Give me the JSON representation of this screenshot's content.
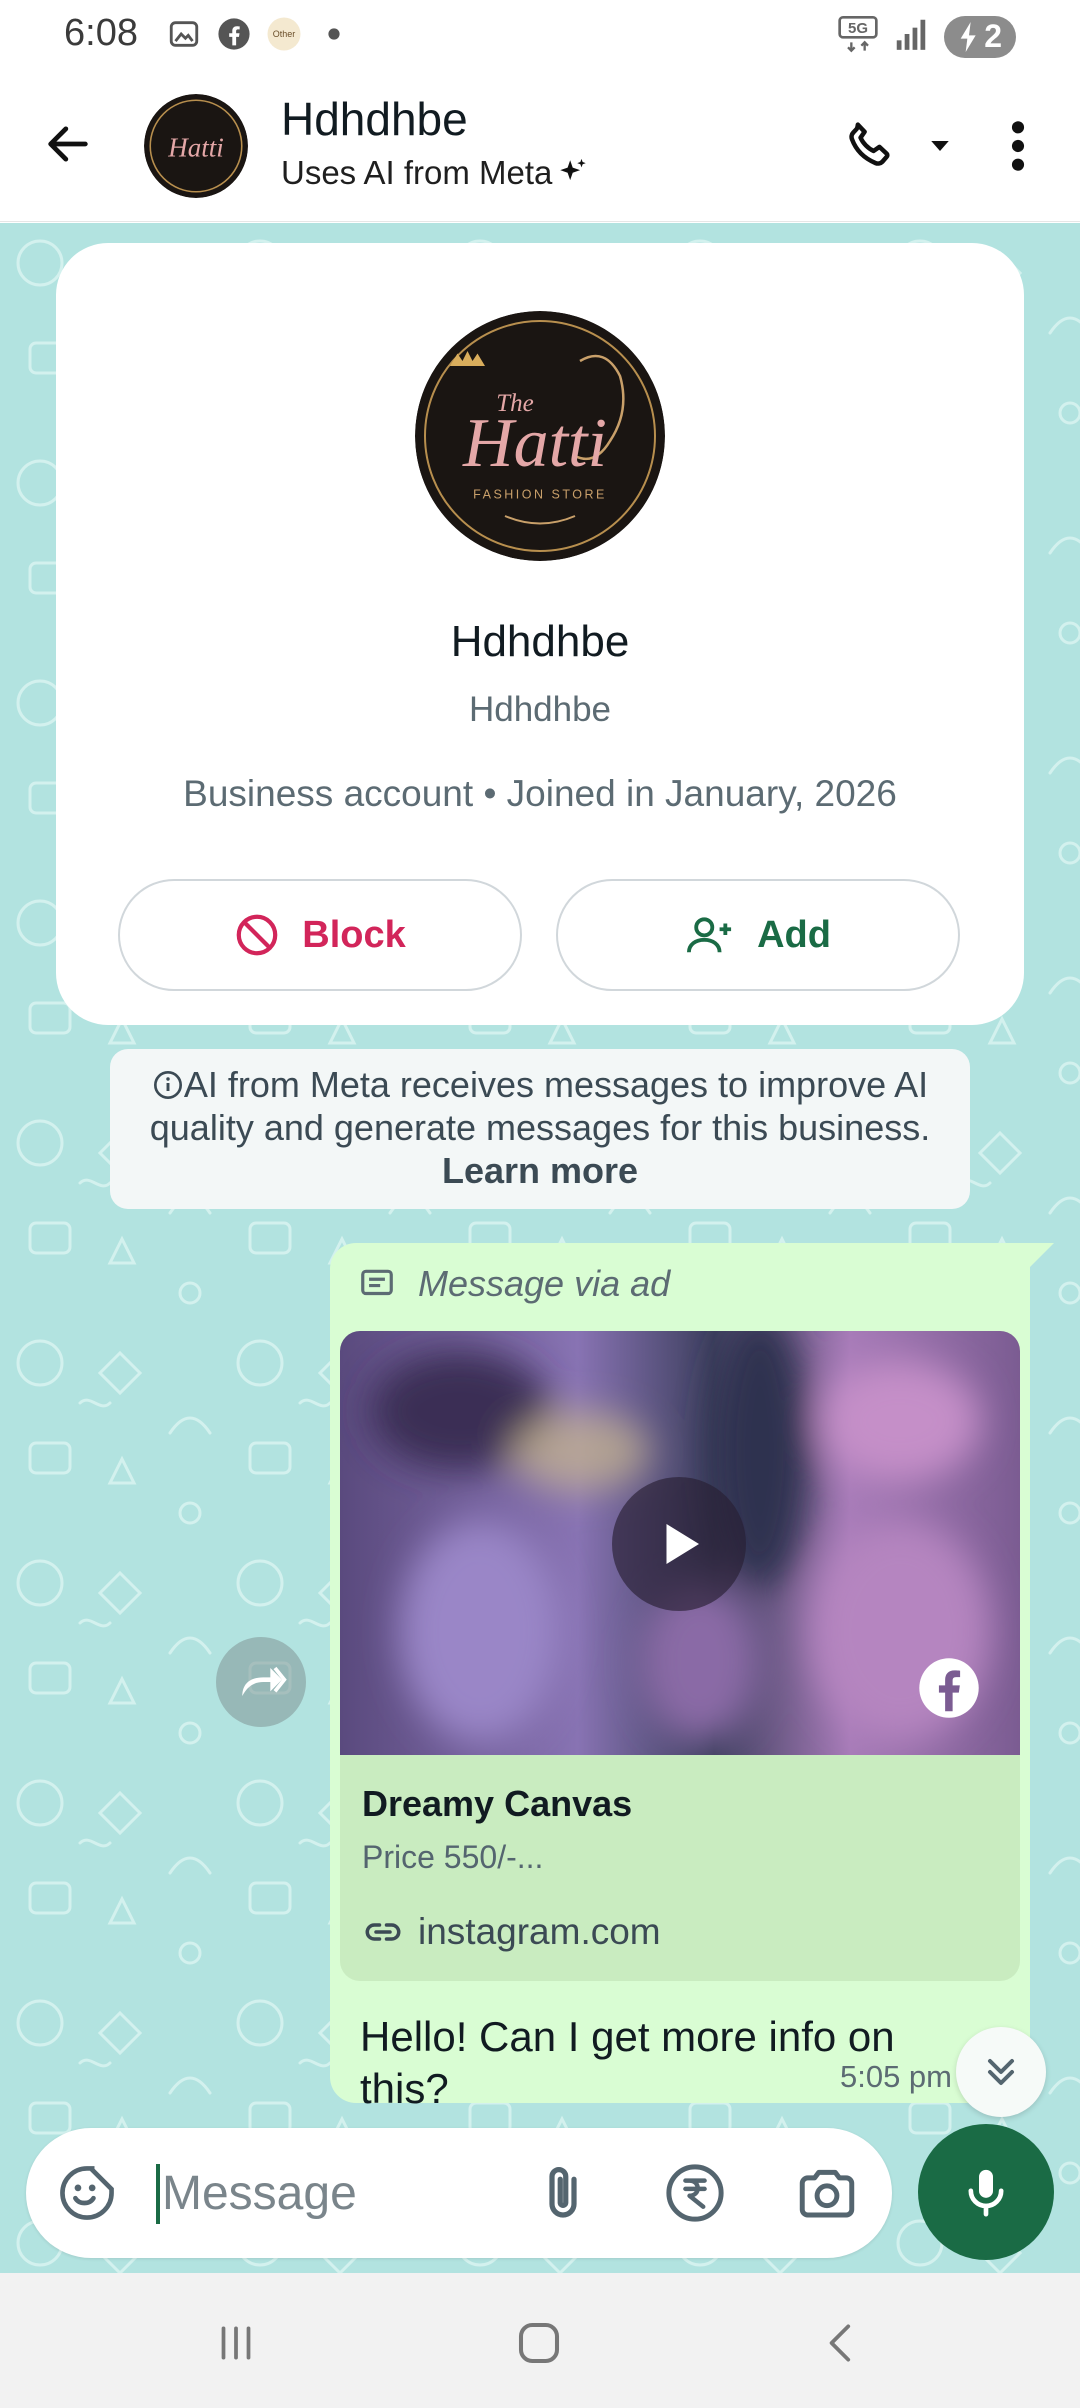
{
  "status_bar": {
    "time": "6:08",
    "left_icons": [
      "gallery-notification-icon",
      "facebook-notification-icon",
      "app-notification-icon",
      "dot-icon"
    ],
    "app_icon_text": "Other",
    "network_label": "5G",
    "battery_level": "2"
  },
  "header": {
    "title": "Hdhdhbe",
    "subtitle": "Uses AI from Meta"
  },
  "profile": {
    "logo_the": "The",
    "logo_name": "Hatti",
    "logo_tagline": "FASHION STORE",
    "name": "Hdhdhbe",
    "secondary_name": "Hdhdhbe",
    "info": "Business account • Joined in January, 2026",
    "block_label": "Block",
    "add_label": "Add"
  },
  "ai_notice": {
    "line1": "AI from Meta receives messages to improve AI",
    "line2": "quality and generate messages for this business.",
    "learn_more": "Learn more"
  },
  "message": {
    "via_ad_label": "Message via ad",
    "ad_title": "Dreamy Canvas",
    "ad_price": "Price 550/-...",
    "ad_link": "instagram.com",
    "text": "Hello! Can I get more info on this?",
    "time": "5:05 pm",
    "status": "read"
  },
  "composer": {
    "placeholder": "Message"
  },
  "colors": {
    "brand_green": "#1a6b45",
    "chat_background": "#b2e3e0",
    "outgoing_bubble": "#d9fdd3",
    "block_red": "#d2255a",
    "read_tick_blue": "#34b7f1"
  }
}
